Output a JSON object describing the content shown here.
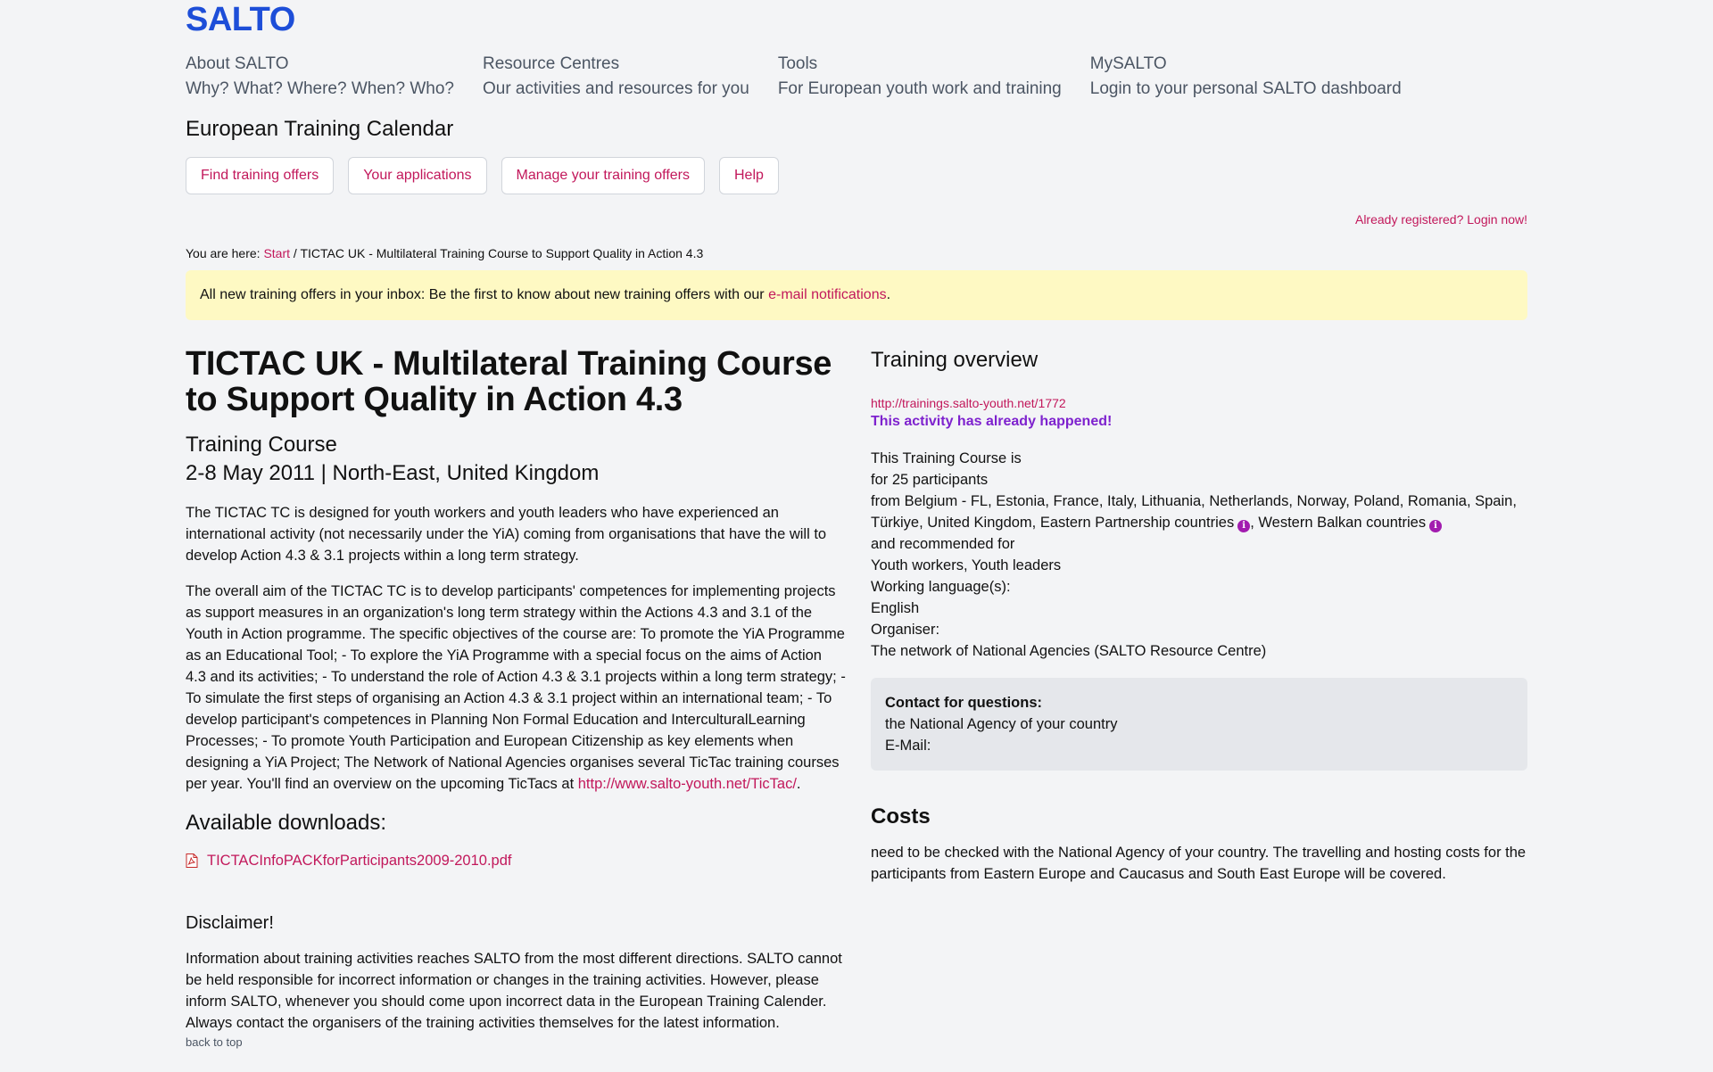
{
  "header": {
    "logo": "SALTO",
    "nav": [
      {
        "title": "About SALTO",
        "subtitle": "Why? What? Where? When? Who?"
      },
      {
        "title": "Resource Centres",
        "subtitle": "Our activities and resources for you"
      },
      {
        "title": "Tools",
        "subtitle": "For European youth work and training"
      },
      {
        "title": "MySALTO",
        "subtitle": "Login to your personal SALTO dashboard"
      }
    ]
  },
  "calendar": {
    "title": "European Training Calendar",
    "tabs": [
      "Find training offers",
      "Your applications",
      "Manage your training offers",
      "Help"
    ],
    "login_link": "Already registered? Login now!"
  },
  "breadcrumb": {
    "prefix": "You are here:",
    "start": "Start",
    "separator": "/",
    "current": "TICTAC UK - Multilateral Training Course to Support Quality in Action 4.3"
  },
  "notice": {
    "text": "All new training offers in your inbox: Be the first to know about new training offers with our",
    "link": "e-mail notifications",
    "end": "."
  },
  "main": {
    "title": "TICTAC UK - Multilateral Training Course to Support Quality in Action 4.3",
    "type": "Training Course",
    "date_location": "2-8 May 2011 | North-East, United Kingdom",
    "para1": "The TICTAC TC is designed for youth workers and youth leaders who have experienced an international activity (not necessarily under the YiA) coming from organisations that have the will to develop Action 4.3 & 3.1 projects within a long term strategy.",
    "para2": "The overall aim of the TICTAC TC is to develop participants' competences for implementing projects as support measures in an organization's long term strategy within the Actions 4.3 and 3.1 of the Youth in Action programme. The specific objectives of the course are: To promote the YiA Programme as an Educational Tool; - To explore the YiA Programme with a special focus on the aims of Action 4.3 and its activities; - To understand the role of Action 4.3 & 3.1 projects within a long term strategy; - To simulate the first steps of organising an Action 4.3 & 3.1 project within an international team; - To develop participant's competences in Planning Non Formal Education and InterculturalLearning Processes; - To promote Youth Participation and European Citizenship as key elements when designing a YiA Project; The Network of National Agencies organises several TicTac training courses per year. You'll find an overview on the upcoming TicTacs at",
    "para2_link": "http://www.salto-youth.net/TicTac/",
    "para2_end": ".",
    "downloads_title": "Available downloads:",
    "download_file": "TICTACInfoPACKforParticipants2009-2010.pdf",
    "disclaimer_title": "Disclaimer!",
    "disclaimer": "Information about training activities reaches SALTO from the most different directions. SALTO cannot be held responsible for incorrect information or changes in the training activities. However, please inform SALTO, whenever you should come upon incorrect data in the European Training Calender. Always contact the organisers of the training activities themselves for the latest information.",
    "back_to_top": "back to top"
  },
  "overview": {
    "title": "Training overview",
    "url": "http://trainings.salto-youth.net/1772",
    "status": "This activity has already happened!",
    "line1": "This Training Course is",
    "line2": "for 25 participants",
    "from_text": "from Belgium - FL, Estonia, France, Italy, Lithuania, Netherlands, Norway, Poland, Romania, Spain, Türkiye, United Kingdom, Eastern Partnership countries",
    "western_balkan": ", Western Balkan countries",
    "recommended_label": "and recommended for",
    "recommended": "Youth workers, Youth leaders",
    "languages_label": "Working language(s):",
    "languages": "English",
    "organiser_label": "Organiser:",
    "organiser": "The network of National Agencies (SALTO Resource Centre)",
    "contact_label": "Contact for questions:",
    "contact_value": "the National Agency of your country",
    "email_label": "E-Mail:",
    "costs_title": "Costs",
    "costs": "need to be checked with the National Agency of your country. The travelling and hosting costs for the participants from Eastern Europe and Caucasus and South East Europe will be covered."
  },
  "colors": {
    "accent": "#c2185b",
    "brand": "#1d4ed8",
    "status": "#7e22ce",
    "notice_bg": "#fef9c3"
  },
  "icons": [
    "pdf-icon",
    "info-icon"
  ]
}
